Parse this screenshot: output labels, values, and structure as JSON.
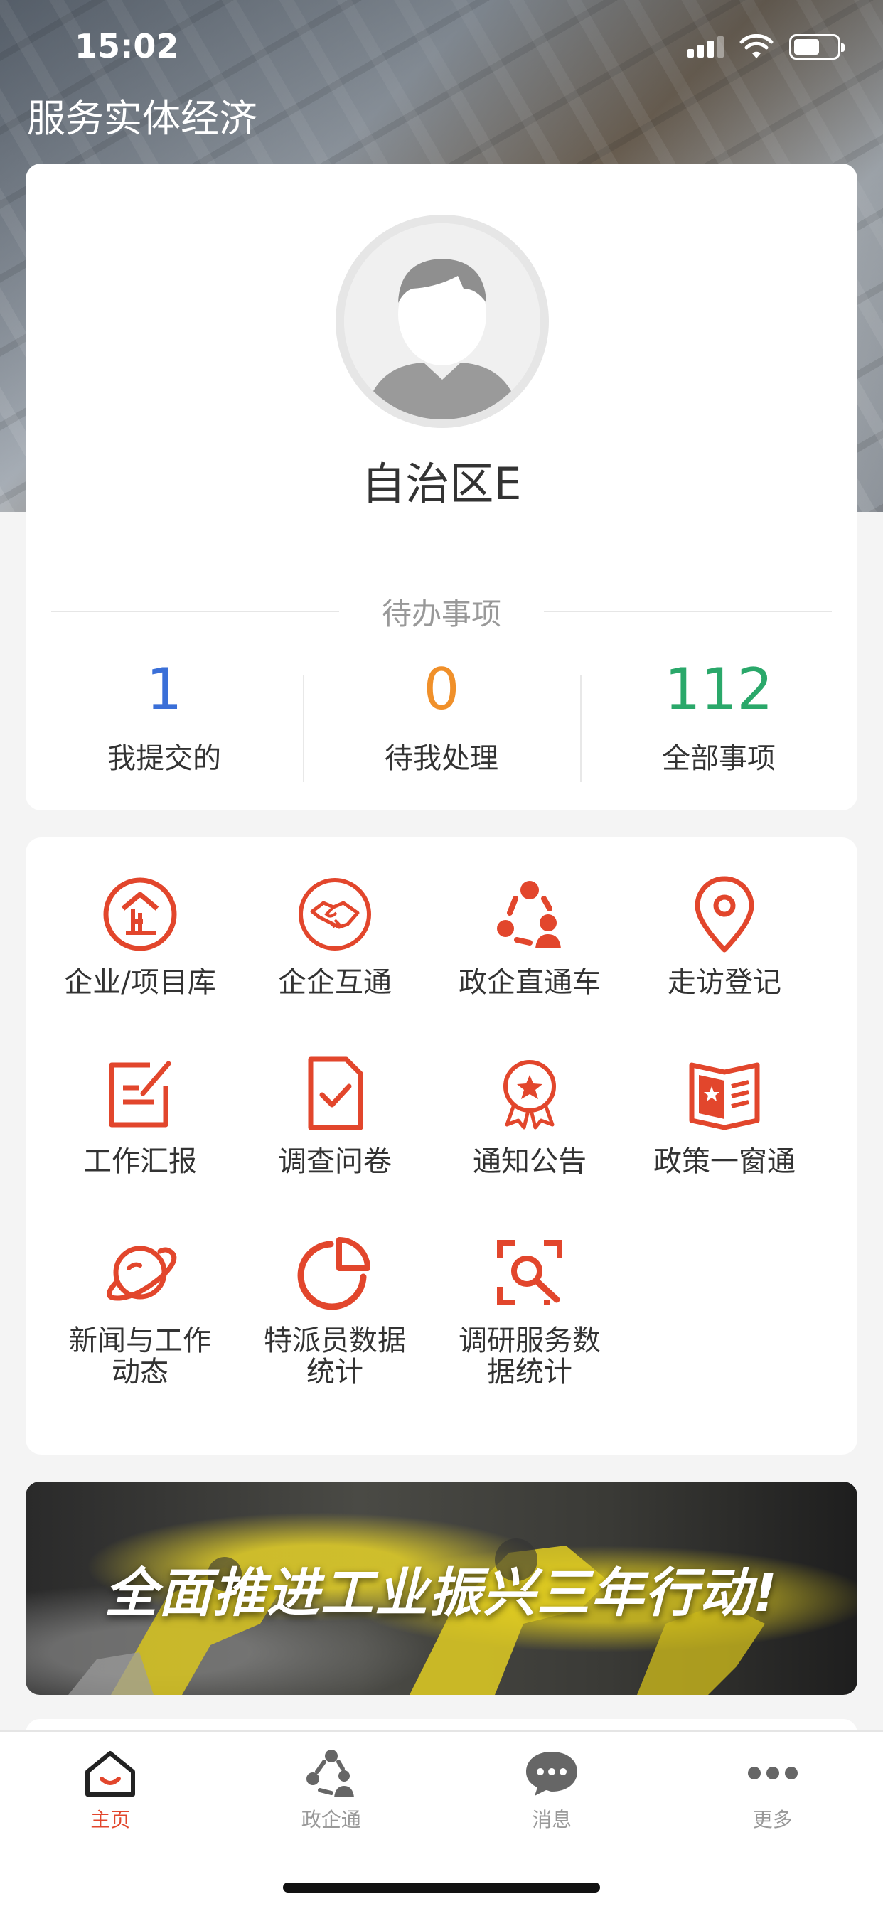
{
  "status": {
    "time": "15:02"
  },
  "app_title": "服务实体经济",
  "profile": {
    "name": "自治区E"
  },
  "todo": {
    "title": "待办事项",
    "stats": [
      {
        "value": "1",
        "label": "我提交的",
        "color": "#3a6fd8"
      },
      {
        "value": "0",
        "label": "待我处理",
        "color": "#f0902a"
      },
      {
        "value": "112",
        "label": "全部事项",
        "color": "#2aa86a"
      }
    ]
  },
  "menu": [
    {
      "label": "企业/项目库",
      "icon": "enterprise-icon"
    },
    {
      "label": "企企互通",
      "icon": "handshake-icon"
    },
    {
      "label": "政企直通车",
      "icon": "network-people-icon"
    },
    {
      "label": "走访登记",
      "icon": "location-pin-icon"
    },
    {
      "label": "工作汇报",
      "icon": "edit-report-icon"
    },
    {
      "label": "调查问卷",
      "icon": "checked-document-icon"
    },
    {
      "label": "通知公告",
      "icon": "award-badge-icon"
    },
    {
      "label": "政策一窗通",
      "icon": "policy-book-icon"
    },
    {
      "label": "新闻与工作动态",
      "icon": "planet-icon"
    },
    {
      "label": "特派员数据统计",
      "icon": "pie-chart-icon"
    },
    {
      "label": "调研服务数据统计",
      "icon": "scan-search-icon"
    }
  ],
  "banner": {
    "text": "全面推进工业振兴三年行动!"
  },
  "tabs": [
    {
      "label": "主页",
      "icon": "home-icon",
      "active": true
    },
    {
      "label": "政企通",
      "icon": "people-network-icon",
      "active": false
    },
    {
      "label": "消息",
      "icon": "chat-icon",
      "active": false
    },
    {
      "label": "更多",
      "icon": "more-dots-icon",
      "active": false
    }
  ],
  "colors": {
    "accent": "#e2462c",
    "icon_red": "#e2462c"
  }
}
